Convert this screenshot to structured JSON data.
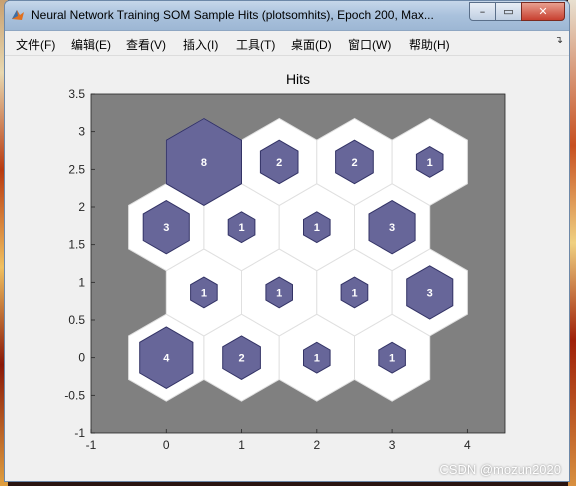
{
  "window": {
    "title": "Neural Network Training SOM Sample Hits (plotsomhits), Epoch 200, Max...",
    "controls": {
      "minimize": "–",
      "maximize": "▭",
      "close": "✕"
    }
  },
  "menubar": {
    "items": [
      "文件(F)",
      "编辑(E)",
      "查看(V)",
      "插入(I)",
      "工具(T)",
      "桌面(D)",
      "窗口(W)",
      "帮助(H)"
    ],
    "overflow_icon": "chevron-right-icon"
  },
  "colors": {
    "plot_background": "#808080",
    "hex_cell": "#ffffff",
    "hit_fill": "#676699",
    "hit_stroke": "#333366"
  },
  "chart_data": {
    "type": "other",
    "title": "Hits",
    "xlabel": "",
    "ylabel": "",
    "xlim": [
      -1,
      4.5
    ],
    "ylim": [
      -1,
      3.5
    ],
    "xticks": [
      "-1",
      "0",
      "1",
      "2",
      "3",
      "4"
    ],
    "yticks": [
      "-1",
      "-0.5",
      "0",
      "0.5",
      "1",
      "1.5",
      "2",
      "2.5",
      "3",
      "3.5"
    ],
    "grid": false,
    "cells": [
      {
        "x": 0,
        "y": 0,
        "hits": 4
      },
      {
        "x": 1,
        "y": 0,
        "hits": 2
      },
      {
        "x": 2,
        "y": 0,
        "hits": 1
      },
      {
        "x": 3,
        "y": 0,
        "hits": 1
      },
      {
        "x": 0.5,
        "y": 0.866,
        "hits": 1
      },
      {
        "x": 1.5,
        "y": 0.866,
        "hits": 1
      },
      {
        "x": 2.5,
        "y": 0.866,
        "hits": 1
      },
      {
        "x": 3.5,
        "y": 0.866,
        "hits": 3
      },
      {
        "x": 0,
        "y": 1.732,
        "hits": 3
      },
      {
        "x": 1,
        "y": 1.732,
        "hits": 1
      },
      {
        "x": 2,
        "y": 1.732,
        "hits": 1
      },
      {
        "x": 3,
        "y": 1.732,
        "hits": 3
      },
      {
        "x": 0.5,
        "y": 2.598,
        "hits": 8
      },
      {
        "x": 1.5,
        "y": 2.598,
        "hits": 2
      },
      {
        "x": 2.5,
        "y": 2.598,
        "hits": 2
      },
      {
        "x": 3.5,
        "y": 2.598,
        "hits": 1
      }
    ],
    "max_hits": 8
  },
  "watermark": "CSDN @mozun2020"
}
